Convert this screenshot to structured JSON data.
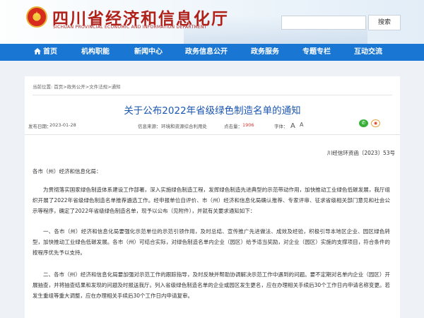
{
  "header": {
    "site_title": "四川省经济和信息化厅",
    "site_subtitle": "SICHUAN PROVINCIAL ECONOMIC AND INFORMATION DEPARTMENT",
    "search_label": "搜索",
    "search_placeholder": ""
  },
  "nav": {
    "items": [
      {
        "label": "首页"
      },
      {
        "label": "机构职能"
      },
      {
        "label": "新闻中心"
      },
      {
        "label": "政务信息公开"
      },
      {
        "label": "政务服务"
      },
      {
        "label": "专题专栏"
      },
      {
        "label": "互动交流"
      }
    ]
  },
  "colors": {
    "nav_bg": "#1976d2",
    "title_red": "#b0211a",
    "doc_title_blue": "#1a56b0",
    "click_count_red": "#dd3333"
  },
  "breadcrumb": "当前位置: 首页>政务公开>文件法规>通知",
  "document": {
    "title": "关于公布2022年省级绿色制造名单的通知",
    "publish_label": "发布日期：",
    "publish_date": "2023-01-28",
    "source_label": "信息来源：",
    "source": "环境和资源综合利用处",
    "clicks_label": "点击量：",
    "clicks": "1906",
    "font_label": "字体：",
    "font_large": "A",
    "font_small": "A",
    "doc_number": "川经信环资函〔2023〕53号",
    "addressee": "各市（州）经济和信息化局：",
    "paragraphs": [
      "为贯彻落实国家绿色制造体系建设工作部署，深入实施绿色制造工程，发挥绿色制造先进典型的示范带动作用，加快推动工业绿色低碳发展，我厅组织开展了2022年省级绿色制造名单推荐遴选工作。经申报单位自评价、市（州）经济和信息化局确认推荐、专家评审、征求省级相关部门意见和社会公示等程序，确定了2022年省级绿色制造名单，现予以公布（见附件），并就有关要求通知如下：",
      "一、各市（州）经济和信息化局要强化示范单位的示范引领作用，及时总结、宣传推广先进做法、成效及经验，积极引导本地区企业、园区绿色转型，加快推动工业绿色低碳发展。各市（州）可结合实际，对绿色制造名单内企业（园区）给予适当奖励，对企业（园区）实施的支撑项目，符合条件的按程序优先予以支持。",
      "二、各市（州）经济和信息化局要加强对示范工作的跟踪指导，及时反映并帮助协调解决示范工作中遇到的问题。要不定期对名单内企业（园区）开展抽查，并将抽查结果和发现的问题及时报送我厅。列入省级绿色制造名单的企业或园区发生更名，应在办理相关手续后30个工作日内申请名称变更。若发生重组等重大调整，应在办理相关手续后30个工作日内申请复审。"
    ]
  }
}
